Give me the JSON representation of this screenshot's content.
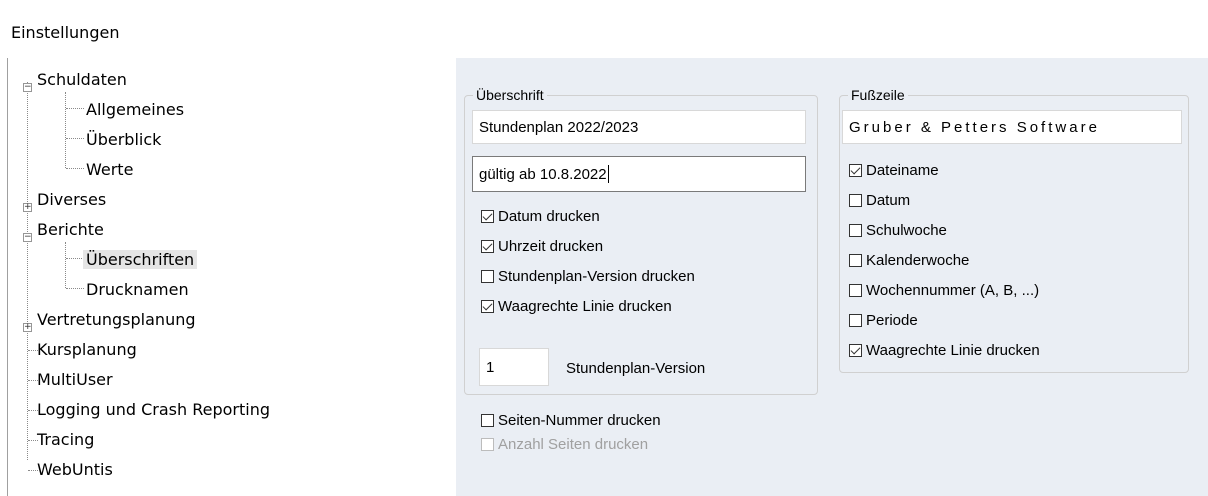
{
  "header": {
    "title": "Einstellungen"
  },
  "tree": {
    "nodes": [
      {
        "label": "Schuldaten",
        "expander": "−"
      },
      {
        "label": "Allgemeines"
      },
      {
        "label": "Überblick"
      },
      {
        "label": "Werte"
      },
      {
        "label": "Diverses",
        "expander": "+"
      },
      {
        "label": "Berichte",
        "expander": "−"
      },
      {
        "label": "Überschriften"
      },
      {
        "label": "Drucknamen"
      },
      {
        "label": "Vertretungsplanung",
        "expander": "+"
      },
      {
        "label": "Kursplanung"
      },
      {
        "label": "MultiUser"
      },
      {
        "label": "Logging und Crash Reporting"
      },
      {
        "label": "Tracing"
      },
      {
        "label": "WebUntis"
      }
    ],
    "selected": "Überschriften"
  },
  "ueberschrift": {
    "group_title": "Überschrift",
    "line1": "Stundenplan 2022/2023",
    "line2": "gültig ab 10.8.2022",
    "checkboxes": [
      {
        "label": "Datum drucken",
        "checked": true
      },
      {
        "label": "Uhrzeit drucken",
        "checked": true
      },
      {
        "label": "Stundenplan-Version drucken",
        "checked": false
      },
      {
        "label": "Waagrechte Linie drucken",
        "checked": true
      }
    ],
    "version_value": "1",
    "version_label": "Stundenplan-Version"
  },
  "seiten": {
    "nummer_label": "Seiten-Nummer drucken",
    "nummer_checked": false,
    "anzahl_label": "Anzahl Seiten drucken",
    "anzahl_checked": false,
    "anzahl_disabled": true
  },
  "fusszeile": {
    "group_title": "Fußzeile",
    "text": "Gruber & Petters Software",
    "checkboxes": [
      {
        "label": "Dateiname",
        "checked": true
      },
      {
        "label": "Datum",
        "checked": false
      },
      {
        "label": "Schulwoche",
        "checked": false
      },
      {
        "label": "Kalenderwoche",
        "checked": false
      },
      {
        "label": "Wochennummer (A, B, ...)",
        "checked": false
      },
      {
        "label": "Periode",
        "checked": false
      },
      {
        "label": "Waagrechte Linie drucken",
        "checked": true
      }
    ]
  },
  "colors": {
    "panel_bg": "#eaeef4",
    "selection_bg": "#e5e5e5",
    "disabled_text": "#a0a0a0"
  }
}
